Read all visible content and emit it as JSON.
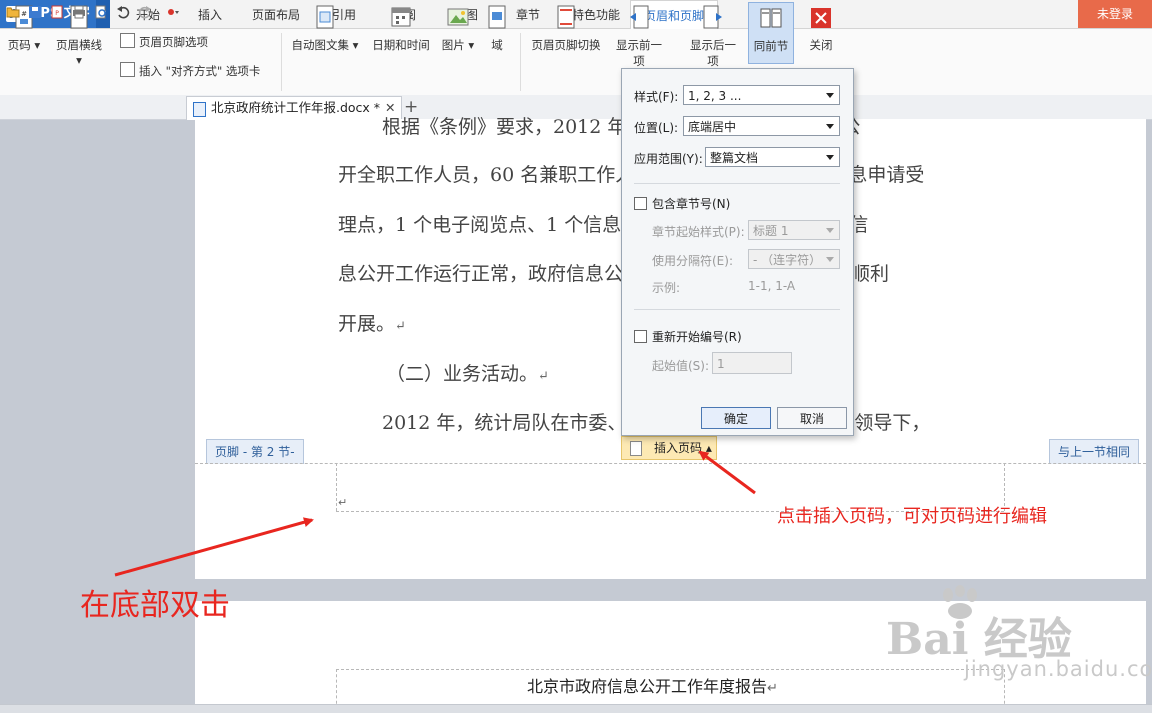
{
  "app": {
    "name": "WPS 文字",
    "login": "未登录"
  },
  "tabs": [
    {
      "label": "开始"
    },
    {
      "label": "插入"
    },
    {
      "label": "页面布局"
    },
    {
      "label": "引用"
    },
    {
      "label": "审阅"
    },
    {
      "label": "视图"
    },
    {
      "label": "章节"
    },
    {
      "label": "特色功能"
    },
    {
      "label": "页眉和页脚"
    }
  ],
  "ribbon": {
    "page_number": "页码",
    "header_line": "页眉横线",
    "header_footer_options": "页眉页脚选项",
    "insert_align_tab": "插入 \"对齐方式\" 选项卡",
    "autotext": "自动图文集",
    "date_time": "日期和时间",
    "picture": "图片",
    "field": "域",
    "switch_header_footer": "页眉页脚切换",
    "show_prev": "显示前一项",
    "show_next": "显示后一项",
    "same_as_prev": "同前节",
    "close": "关闭"
  },
  "doc": {
    "filename": "北京政府统计工作年报.docx *"
  },
  "body_lines": [
    "根据《条例》要求，2012 年统计局队设有 名政府信息公",
    "开全职工作人员，60 名兼职工作人员，设立了 5 个部门的信息申请受",
    "理点，1 个电子阅览点、1 个信息查阅点，全市统计局队政府信",
    "息公开工作运行正常，政府信息公开及依申请公开答复工作均顺利",
    "开展。",
    "（二）业务活动。",
    "2012 年，统计局队在市委、市政府和国家统计局的正确领导下，"
  ],
  "footer": {
    "section_tag": "页脚  - 第 2 节-",
    "same_as_previous": "与上一节相同",
    "insert_page_number": "插入页码"
  },
  "page2_header": "北京市政府信息公开工作年度报告",
  "dialog": {
    "style_label": "样式(F):",
    "style_value": "1, 2, 3 ...",
    "position_label": "位置(L):",
    "position_value": "底端居中",
    "scope_label": "应用范围(Y):",
    "scope_value": "整篇文档",
    "include_chapter": "包含章节号(N)",
    "chapter_style_label": "章节起始样式(P):",
    "chapter_style_value": "标题 1",
    "separator_label": "使用分隔符(E):",
    "separator_value": "-  （连字符）",
    "example_label": "示例:",
    "example_value": "1-1, 1-A",
    "restart_numbering": "重新开始编号(R)",
    "start_label": "起始值(S):",
    "start_value": "1",
    "ok": "确定",
    "cancel": "取消"
  },
  "annotations": {
    "double_click_bottom": "在底部双击",
    "click_insert_page_number": "点击插入页码，可对页码进行编辑"
  },
  "watermark": {
    "brand": "Bai 经验",
    "url": "jingyan.baidu.com"
  },
  "colors": {
    "accent": "#2f73c8",
    "annotation": "#e8261f",
    "login_bg": "#e86a4a"
  }
}
